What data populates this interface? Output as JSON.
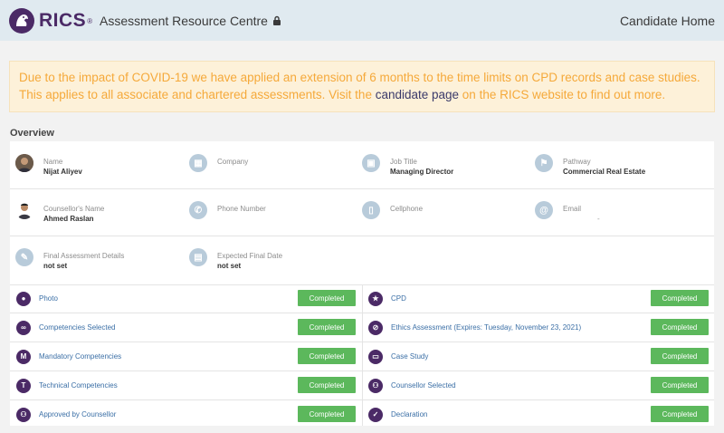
{
  "header": {
    "brand": "RICS",
    "site_title": "Assessment Resource Centre",
    "home_link": "Candidate Home"
  },
  "notice": {
    "text_before": "Due to the impact of COVID-19 we have applied an extension of 6 months to the time limits on CPD records and case studies. This applies to all associate and chartered assessments. Visit the ",
    "link_text": "candidate page",
    "text_after": " on the RICS website to find out more."
  },
  "overview": {
    "title": "Overview",
    "fields": {
      "name": {
        "label": "Name",
        "value": "Nijat Aliyev"
      },
      "company": {
        "label": "Company",
        "value": ""
      },
      "job_title": {
        "label": "Job Title",
        "value": "Managing Director"
      },
      "pathway": {
        "label": "Pathway",
        "value": "Commercial Real Estate"
      },
      "counsellor": {
        "label": "Counsellor's Name",
        "value": "Ahmed Raslan"
      },
      "phone": {
        "label": "Phone Number",
        "value": ""
      },
      "cellphone": {
        "label": "Cellphone",
        "value": ""
      },
      "email": {
        "label": "Email",
        "value": "-"
      },
      "final_assessment": {
        "label": "Final Assessment Details",
        "value": "not set"
      },
      "expected_date": {
        "label": "Expected Final Date",
        "value": "not set"
      }
    },
    "left_items": [
      {
        "label": "Photo",
        "icon": "person-icon",
        "status": "Completed"
      },
      {
        "label": "Competencies Selected",
        "icon": "link-icon",
        "status": "Completed"
      },
      {
        "label": "Mandatory Competencies",
        "icon": "letter-m-icon",
        "status": "Completed"
      },
      {
        "label": "Technical Competencies",
        "icon": "letter-t-icon",
        "status": "Completed"
      },
      {
        "label": "Approved by Counsellor",
        "icon": "users-icon",
        "status": "Completed"
      }
    ],
    "right_items": [
      {
        "label": "CPD",
        "icon": "star-icon",
        "status": "Completed"
      },
      {
        "label": "Ethics Assessment (Expires: Tuesday, November 23, 2021)",
        "icon": "ban-icon",
        "status": "Completed"
      },
      {
        "label": "Case Study",
        "icon": "folder-icon",
        "status": "Completed"
      },
      {
        "label": "Counsellor Selected",
        "icon": "users-icon",
        "status": "Completed"
      },
      {
        "label": "Declaration",
        "icon": "check-icon",
        "status": "Completed"
      }
    ]
  },
  "colors": {
    "brand_purple": "#4b2a66",
    "completed_green": "#5cb85c",
    "notice_orange": "#f5a93a",
    "header_bg": "#e0eaf0"
  }
}
